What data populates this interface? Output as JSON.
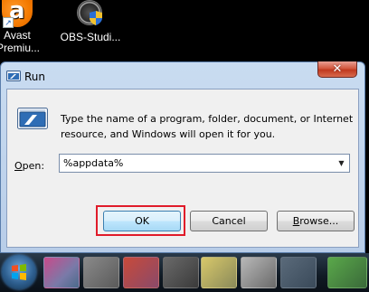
{
  "desktop": {
    "icons": [
      {
        "label_line1": "Avast",
        "label_line2": "Premiu..."
      },
      {
        "label": "OBS-Studi..."
      }
    ]
  },
  "dialog": {
    "title": "Run",
    "close_glyph": "✕",
    "description": "Type the name of a program, folder, document, or Internet resource, and Windows will open it for you.",
    "open_label_mnemonic": "O",
    "open_label_rest": "pen:",
    "open_value": "%appdata%",
    "combo_arrow": "▼",
    "buttons": {
      "ok": "OK",
      "cancel": "Cancel",
      "browse_mnemonic": "B",
      "browse_rest": "rowse..."
    }
  },
  "colors": {
    "highlight": "#e01b2a",
    "dialog_frame": "#c9dcf1",
    "ok_button": "#bee6fd"
  }
}
